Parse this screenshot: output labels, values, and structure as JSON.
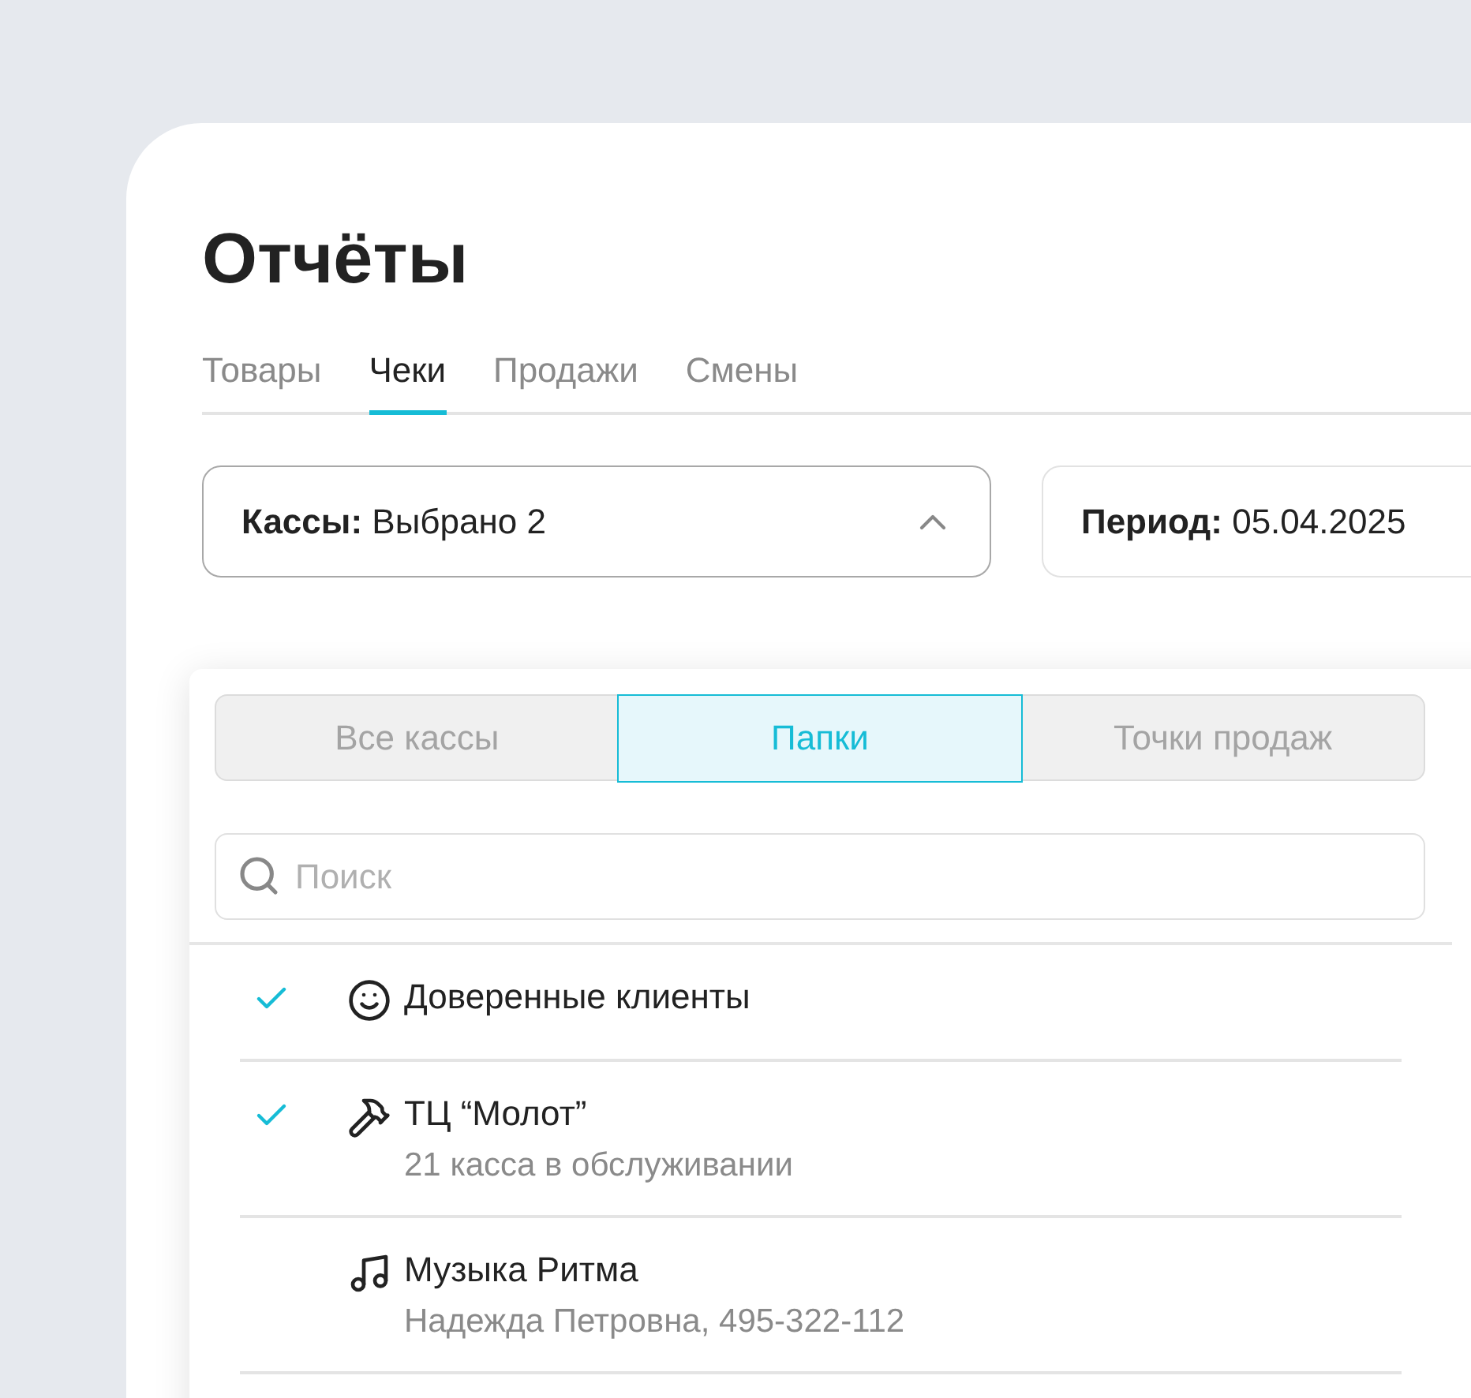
{
  "title": "Отчёты",
  "tabs": [
    {
      "label": "Товары",
      "selected": false
    },
    {
      "label": "Чеки",
      "selected": true
    },
    {
      "label": "Продажи",
      "selected": false
    },
    {
      "label": "Смены",
      "selected": false
    }
  ],
  "filters": [
    {
      "label": "Кассы:",
      "value": "Выбрано 2",
      "expanded": true
    },
    {
      "label": "Период:",
      "value": "05.04.2025",
      "expanded": false
    }
  ],
  "dropdown": {
    "segments": [
      {
        "label": "Все кассы",
        "selected": false
      },
      {
        "label": "Папки",
        "selected": true
      },
      {
        "label": "Точки продаж",
        "selected": false
      }
    ],
    "search": {
      "placeholder": "Поиск"
    },
    "items": [
      {
        "title": "Доверенные клиенты",
        "checked": true
      },
      {
        "title": "ТЦ “Молот”",
        "subtitle": "21 касса в обслуживании",
        "checked": true
      },
      {
        "title": "Музыка Ритма",
        "subtitle": "Надежда Петровна, 495-322-112",
        "checked": false
      }
    ]
  }
}
